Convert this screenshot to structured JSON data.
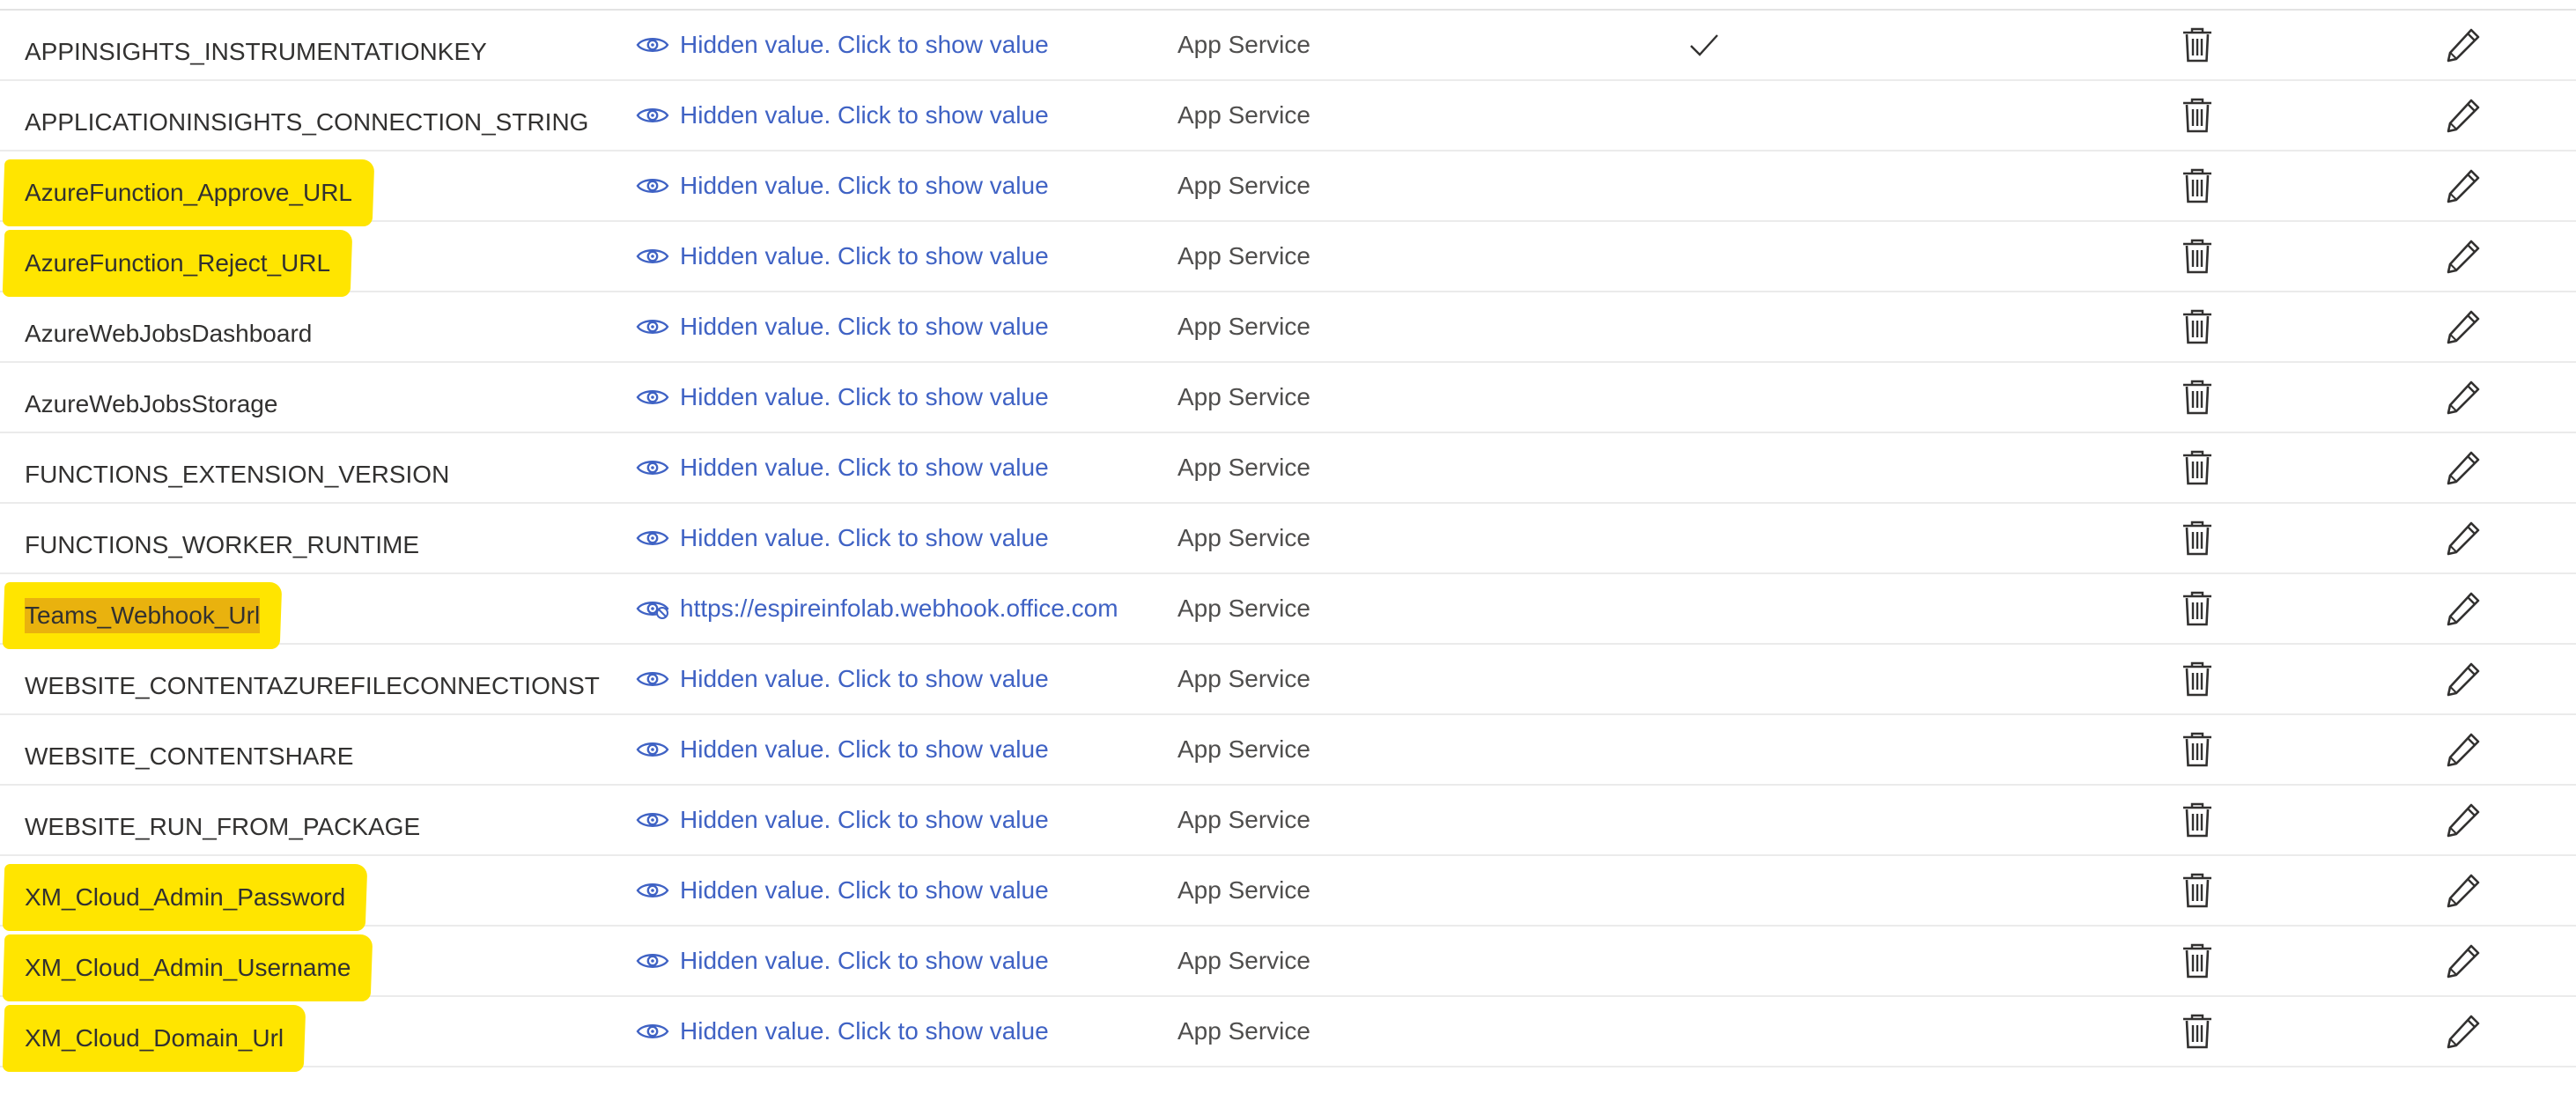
{
  "table": {
    "rows": [
      {
        "name": "APPINSIGHTS_INSTRUMENTATIONKEY",
        "value": "Hidden value. Click to show value",
        "source": "App Service",
        "slot_setting": true,
        "highlight": false,
        "revealed": false
      },
      {
        "name": "APPLICATIONINSIGHTS_CONNECTION_STRING",
        "value": "Hidden value. Click to show value",
        "source": "App Service",
        "slot_setting": false,
        "highlight": false,
        "revealed": false
      },
      {
        "name": "AzureFunction_Approve_URL",
        "value": "Hidden value. Click to show value",
        "source": "App Service",
        "slot_setting": false,
        "highlight": true,
        "revealed": false
      },
      {
        "name": "AzureFunction_Reject_URL",
        "value": "Hidden value. Click to show value",
        "source": "App Service",
        "slot_setting": false,
        "highlight": true,
        "revealed": false
      },
      {
        "name": "AzureWebJobsDashboard",
        "value": "Hidden value. Click to show value",
        "source": "App Service",
        "slot_setting": false,
        "highlight": false,
        "revealed": false
      },
      {
        "name": "AzureWebJobsStorage",
        "value": "Hidden value. Click to show value",
        "source": "App Service",
        "slot_setting": false,
        "highlight": false,
        "revealed": false
      },
      {
        "name": "FUNCTIONS_EXTENSION_VERSION",
        "value": "Hidden value. Click to show value",
        "source": "App Service",
        "slot_setting": false,
        "highlight": false,
        "revealed": false
      },
      {
        "name": "FUNCTIONS_WORKER_RUNTIME",
        "value": "Hidden value. Click to show value",
        "source": "App Service",
        "slot_setting": false,
        "highlight": false,
        "revealed": false
      },
      {
        "name": "Teams_Webhook_Url",
        "value": "https://espireinfolab.webhook.office.com",
        "source": "App Service",
        "slot_setting": false,
        "highlight": true,
        "selected": true,
        "revealed": true
      },
      {
        "name": "WEBSITE_CONTENTAZUREFILECONNECTIONST",
        "value": "Hidden value. Click to show value",
        "source": "App Service",
        "slot_setting": false,
        "highlight": false,
        "revealed": false
      },
      {
        "name": "WEBSITE_CONTENTSHARE",
        "value": "Hidden value. Click to show value",
        "source": "App Service",
        "slot_setting": false,
        "highlight": false,
        "revealed": false
      },
      {
        "name": "WEBSITE_RUN_FROM_PACKAGE",
        "value": "Hidden value. Click to show value",
        "source": "App Service",
        "slot_setting": false,
        "highlight": false,
        "revealed": false
      },
      {
        "name": "XM_Cloud_Admin_Password",
        "value": "Hidden value. Click to show value",
        "source": "App Service",
        "slot_setting": false,
        "highlight": true,
        "revealed": false
      },
      {
        "name": "XM_Cloud_Admin_Username",
        "value": "Hidden value. Click to show value",
        "source": "App Service",
        "slot_setting": false,
        "highlight": true,
        "revealed": false
      },
      {
        "name": "XM_Cloud_Domain_Url",
        "value": "Hidden value. Click to show value",
        "source": "App Service",
        "slot_setting": false,
        "highlight": true,
        "revealed": false
      }
    ]
  },
  "icons": {
    "value": "eye-icon",
    "value_revealed": "eye-hide-icon",
    "slot_setting": "checkmark-icon",
    "delete": "trash-icon",
    "edit": "pencil-icon"
  },
  "colors": {
    "link": "#3f62c4",
    "text": "#323130",
    "highlight": "#ffe500",
    "selection": "#e2a013",
    "divider": "#ebebeb"
  }
}
